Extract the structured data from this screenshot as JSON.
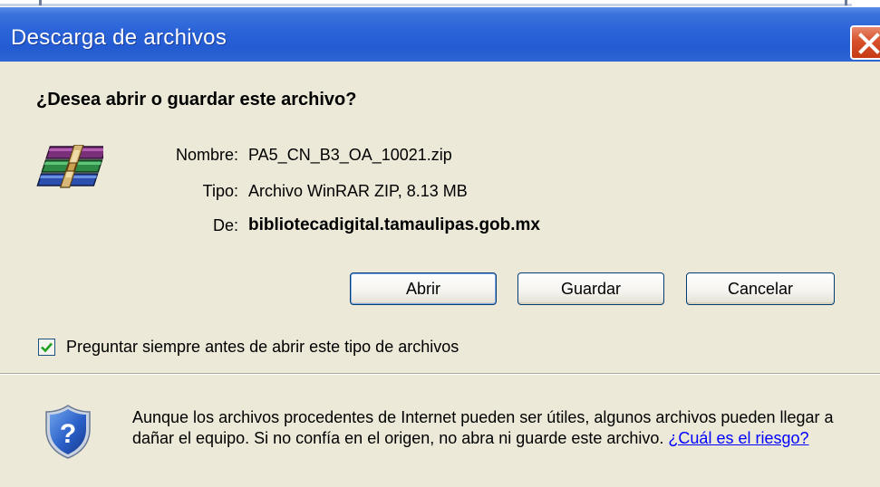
{
  "window": {
    "title": "Descarga de archivos",
    "close_icon": "close-x-icon"
  },
  "dialog": {
    "question": "¿Desea abrir o guardar este archivo?",
    "file_icon": "winrar-archive-icon",
    "fields": {
      "name_label": "Nombre:",
      "name_value": "PA5_CN_B3_OA_10021.zip",
      "type_label": "Tipo:",
      "type_value": "Archivo WinRAR ZIP, 8.13 MB",
      "from_label": "De:",
      "from_value": "bibliotecadigital.tamaulipas.gob.mx"
    },
    "buttons": {
      "open": "Abrir",
      "save": "Guardar",
      "cancel": "Cancelar"
    },
    "always_ask": {
      "checked": true,
      "label": "Preguntar siempre antes de abrir este tipo de archivos"
    },
    "warning": {
      "icon": "shield-question-icon",
      "text": "Aunque los archivos procedentes de Internet pueden ser útiles, algunos archivos pueden llegar a dañar el equipo. Si no confía en el origen, no abra ni guarde este archivo.",
      "link": "¿Cuál es el riesgo?"
    }
  },
  "colors": {
    "titlebar": "#245bd2",
    "dialog_bg": "#ece9d8",
    "link": "#0000ff",
    "close_button": "#d6512c"
  }
}
